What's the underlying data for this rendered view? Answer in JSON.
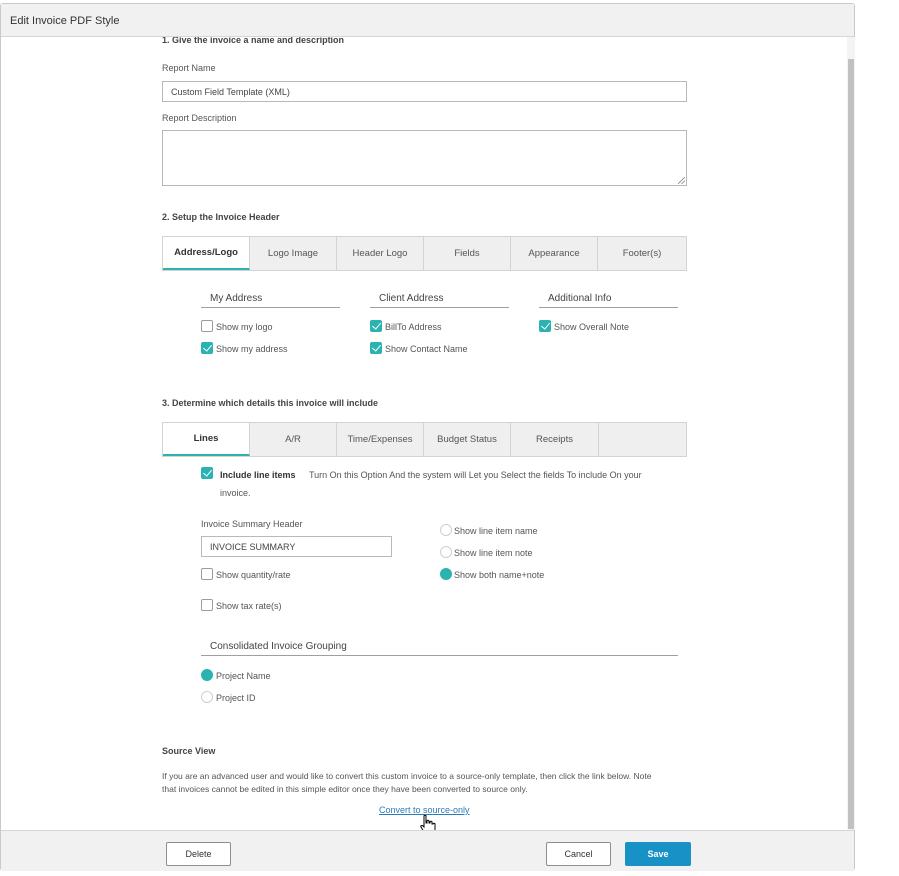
{
  "dialog": {
    "title": "Edit Invoice PDF Style"
  },
  "section1": {
    "title": "1. Give the invoice a name and description",
    "report_name_label": "Report Name",
    "report_name_value": "Custom Field Template (XML)",
    "report_description_label": "Report Description",
    "report_description_value": ""
  },
  "section2": {
    "title": "2. Setup the Invoice Header",
    "tabs": [
      "Address/Logo",
      "Logo Image",
      "Header Logo",
      "Fields",
      "Appearance",
      "Footer(s)"
    ],
    "active_tab": "Address/Logo",
    "columns": {
      "my_address": {
        "title": "My Address",
        "options": [
          {
            "label": "Show my logo",
            "checked": false
          },
          {
            "label": "Show my address",
            "checked": true
          }
        ]
      },
      "client_address": {
        "title": "Client Address",
        "options": [
          {
            "label": "BillTo Address",
            "checked": true
          },
          {
            "label": "Show Contact Name",
            "checked": true
          }
        ]
      },
      "additional_info": {
        "title": "Additional Info",
        "options": [
          {
            "label": "Show Overall Note",
            "checked": true
          }
        ]
      }
    }
  },
  "section3": {
    "title": "3. Determine which details this invoice will include",
    "tabs": [
      "Lines",
      "A/R",
      "Time/Expenses",
      "Budget Status",
      "Receipts"
    ],
    "active_tab": "Lines",
    "include_line_items": {
      "checked": true,
      "label": "Include line items",
      "description_line1": "Turn On this Option And the system will Let you Select the fields To include On your",
      "description_line2": "invoice."
    },
    "summary_header_label": "Invoice Summary Header",
    "summary_header_value": "INVOICE SUMMARY",
    "show_quantity_rate": {
      "label": "Show quantity/rate",
      "checked": false
    },
    "show_tax_rate": {
      "label": "Show tax rate(s)",
      "checked": false
    },
    "line_display": [
      {
        "label": "Show line item name",
        "selected": false
      },
      {
        "label": "Show line item note",
        "selected": false
      },
      {
        "label": "Show both name+note",
        "selected": true
      }
    ],
    "grouping_title": "Consolidated Invoice Grouping",
    "grouping": [
      {
        "label": "Project Name",
        "selected": true
      },
      {
        "label": "Project ID",
        "selected": false
      }
    ]
  },
  "source_view": {
    "title": "Source View",
    "description_line1": "If you are an advanced user and would like to convert this custom invoice to a source-only template, then click the link below. Note",
    "description_line2": "that invoices cannot be edited in this simple editor once they have been converted to source only.",
    "link": "Convert to source-only"
  },
  "footer": {
    "delete_label": "Delete",
    "cancel_label": "Cancel",
    "save_label": "Save"
  },
  "colors": {
    "accent": "#2bb3b1",
    "primary_button": "#1891c7",
    "link": "#2a7ab8"
  }
}
